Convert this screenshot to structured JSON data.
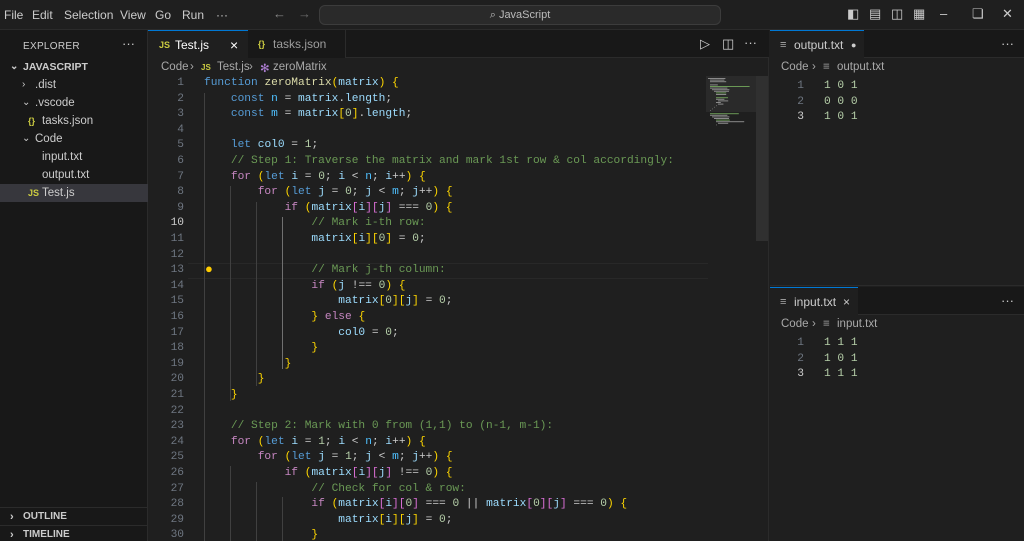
{
  "titlebar": {
    "menu": [
      "File",
      "Edit",
      "Selection",
      "View",
      "Go",
      "Run",
      "···"
    ],
    "search": "JavaScript"
  },
  "sidebar": {
    "header": "EXPLORER",
    "more": "···",
    "root": "JAVASCRIPT",
    "items": [
      {
        "label": ".dist",
        "type": "folder"
      },
      {
        "label": ".vscode",
        "type": "folder"
      },
      {
        "label": "tasks.json",
        "type": "json",
        "icon": "{}"
      },
      {
        "label": "Code",
        "type": "folder"
      },
      {
        "label": "input.txt",
        "type": "txt"
      },
      {
        "label": "output.txt",
        "type": "txt"
      },
      {
        "label": "Test.js",
        "type": "js",
        "icon": "JS"
      }
    ],
    "outline": "OUTLINE",
    "timeline": "TIMELINE"
  },
  "editor": {
    "tabs": [
      {
        "label": "Test.js",
        "icon": "JS",
        "close": "×"
      },
      {
        "label": "tasks.json",
        "icon": "{}"
      }
    ],
    "breadcrumb": [
      "Code",
      "Test.js",
      "zeroMatrix"
    ],
    "current_line": 10,
    "lines": [
      {
        "n": "1",
        "t": "function zeroMatrix(matrix) {"
      },
      {
        "n": "2",
        "t": "    const n = matrix.length;"
      },
      {
        "n": "3",
        "t": "    const m = matrix[0].length;"
      },
      {
        "n": "4",
        "t": ""
      },
      {
        "n": "5",
        "t": "    let col0 = 1;"
      },
      {
        "n": "6",
        "t": "    // Step 1: Traverse the matrix and mark 1st row & col accordingly:"
      },
      {
        "n": "7",
        "t": "    for (let i = 0; i < n; i++) {"
      },
      {
        "n": "8",
        "t": "        for (let j = 0; j < m; j++) {"
      },
      {
        "n": "9",
        "t": "            if (matrix[i][j] === 0) {"
      },
      {
        "n": "10",
        "t": "                // Mark i-th row:"
      },
      {
        "n": "11",
        "t": "                matrix[i][0] = 0;"
      },
      {
        "n": "12",
        "t": ""
      },
      {
        "n": "13",
        "t": "                // Mark j-th column:"
      },
      {
        "n": "14",
        "t": "                if (j !== 0) {"
      },
      {
        "n": "15",
        "t": "                    matrix[0][j] = 0;"
      },
      {
        "n": "16",
        "t": "                } else {"
      },
      {
        "n": "17",
        "t": "                    col0 = 0;"
      },
      {
        "n": "18",
        "t": "                }"
      },
      {
        "n": "19",
        "t": "            }"
      },
      {
        "n": "20",
        "t": "        }"
      },
      {
        "n": "21",
        "t": "    }"
      },
      {
        "n": "22",
        "t": ""
      },
      {
        "n": "23",
        "t": "    // Step 2: Mark with 0 from (1,1) to (n-1, m-1):"
      },
      {
        "n": "24",
        "t": "    for (let i = 1; i < n; i++) {"
      },
      {
        "n": "25",
        "t": "        for (let j = 1; j < m; j++) {"
      },
      {
        "n": "26",
        "t": "            if (matrix[i][j] !== 0) {"
      },
      {
        "n": "27",
        "t": "                // Check for col & row:"
      },
      {
        "n": "28",
        "t": "                if (matrix[i][0] === 0 || matrix[0][j] === 0) {"
      },
      {
        "n": "29",
        "t": "                    matrix[i][j] = 0;"
      },
      {
        "n": "30",
        "t": "                }"
      }
    ]
  },
  "output_pane": {
    "tab": "output.txt",
    "breadcrumb": [
      "Code",
      "output.txt"
    ],
    "more": "···",
    "lines": [
      {
        "n": "1",
        "t": "1 0 1"
      },
      {
        "n": "2",
        "t": "0 0 0"
      },
      {
        "n": "3",
        "t": "1 0 1"
      }
    ]
  },
  "input_pane": {
    "tab": "input.txt",
    "breadcrumb": [
      "Code",
      "input.txt"
    ],
    "more": "···",
    "lines": [
      {
        "n": "1",
        "t": "1 1 1"
      },
      {
        "n": "2",
        "t": "1 0 1"
      },
      {
        "n": "3",
        "t": "1 1 1"
      }
    ]
  }
}
